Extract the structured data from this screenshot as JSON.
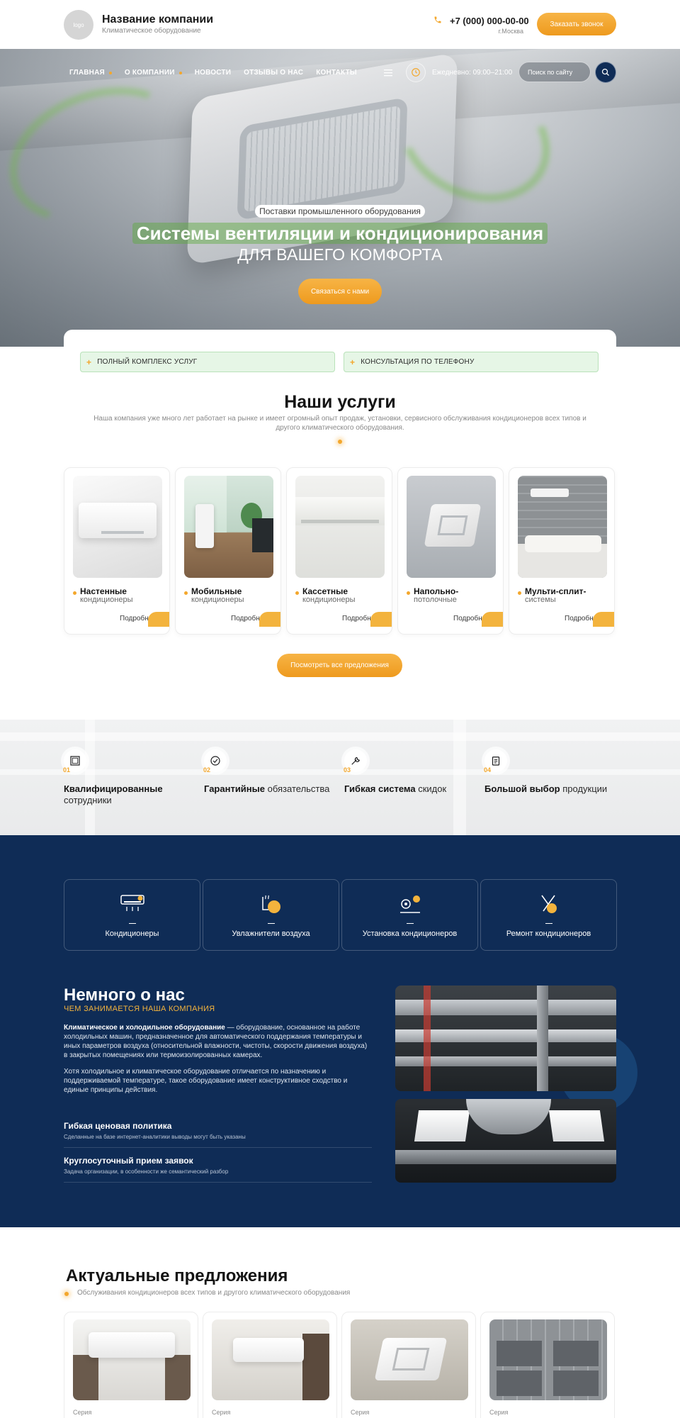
{
  "header": {
    "logo_text": "logo",
    "company_name": "Название компании",
    "company_subtitle": "Климатическое оборудование",
    "phone": "+7 (000) 000-00-00",
    "city": "г.Москва",
    "call_button": "Заказать звонок"
  },
  "nav": {
    "items": [
      {
        "label": "ГЛАВНАЯ",
        "has_dropdown": true
      },
      {
        "label": "О КОМПАНИИ",
        "has_dropdown": true
      },
      {
        "label": "НОВОСТИ",
        "has_dropdown": false
      },
      {
        "label": "ОТЗЫВЫ О НАС",
        "has_dropdown": false
      },
      {
        "label": "КОНТАКТЫ",
        "has_dropdown": false
      }
    ],
    "menu_icon": "hamburger-icon",
    "hours": "Ежедневно: 09:00–21:00",
    "search_placeholder": "Поиск по сайту"
  },
  "hero": {
    "kicker": "Поставки промышленного оборудования",
    "title": "Системы вентиляции и кондиционирования",
    "subtitle": "ДЛЯ ВАШЕГО КОМФОРТА",
    "button": "Связаться с нами"
  },
  "features": {
    "items": [
      "ПОЛНЫЙ КОМПЛЕКС УСЛУГ",
      "КОНСУЛЬТАЦИЯ ПО ТЕЛЕФОНУ"
    ]
  },
  "services": {
    "title": "Наши услуги",
    "description": "Наша компания уже много лет работает на рынке и имеет огромный опыт продаж, установки, сервисного обслуживания кондиционеров всех типов и другого климатического оборудования.",
    "more_label": "Подробнее",
    "cards": [
      {
        "name": "Настенные",
        "sub": "кондиционеры"
      },
      {
        "name": "Мобильные",
        "sub": "кондиционеры"
      },
      {
        "name": "Кассетные",
        "sub": "кондиционеры"
      },
      {
        "name": "Напольно-",
        "sub": "потолочные"
      },
      {
        "name": "Мульти-сплит-",
        "sub": "системы"
      }
    ],
    "all_button": "Посмотреть все предложения"
  },
  "advantages": [
    {
      "num": "01",
      "bold": "Квалифицированные",
      "rest": "сотрудники",
      "icon": "certificate-icon"
    },
    {
      "num": "02",
      "bold": "Гарантийные",
      "rest": "обязательства",
      "icon": "badge-check-icon"
    },
    {
      "num": "03",
      "bold": "Гибкая система",
      "rest": "скидок",
      "icon": "tools-icon"
    },
    {
      "num": "04",
      "bold": "Большой выбор",
      "rest": "продукции",
      "icon": "clipboard-icon"
    }
  ],
  "categories": [
    {
      "label": "Кондиционеры",
      "icon": "air-conditioner-icon"
    },
    {
      "label": "Увлажнители воздуха",
      "icon": "humidifier-icon"
    },
    {
      "label": "Установка кондиционеров",
      "icon": "installation-icon"
    },
    {
      "label": "Ремонт кондиционеров",
      "icon": "repair-icon"
    }
  ],
  "about": {
    "title": "Немного о нас",
    "kicker": "ЧЕМ ЗАНИМАЕТСЯ НАША КОМПАНИЯ",
    "p1_bold": "Климатическое и холодильное оборудование",
    "p1_rest": " — оборудование, основанное на работе холодильных машин, предназначенное для автоматического поддержания температуры и иных параметров воздуха (относительной влажности, чистоты, скорости движения воздуха) в закрытых помещениях или термоизолированных камерах.",
    "p2": "Хотя холодильное и климатическое оборудование отличается по назначению и поддерживаемой температуре, такое оборудование имеет конструктивное сходство и единые принципы действия.",
    "points": [
      {
        "title": "Гибкая ценовая политика",
        "text": "Сделанные на базе интернет-аналитики выводы могут быть указаны"
      },
      {
        "title": "Круглосуточный прием заявок",
        "text": "Задача организации, в особенности же семантический разбор"
      }
    ]
  },
  "offers": {
    "title": "Актуальные предложения",
    "subtitle": "Обслуживания кондиционеров всех типов и другого климатического оборудования",
    "series_label": "Серия"
  },
  "colors": {
    "accent": "#f3a72c",
    "navy": "#0f2c56",
    "feature_green": "#e6f6e6"
  }
}
